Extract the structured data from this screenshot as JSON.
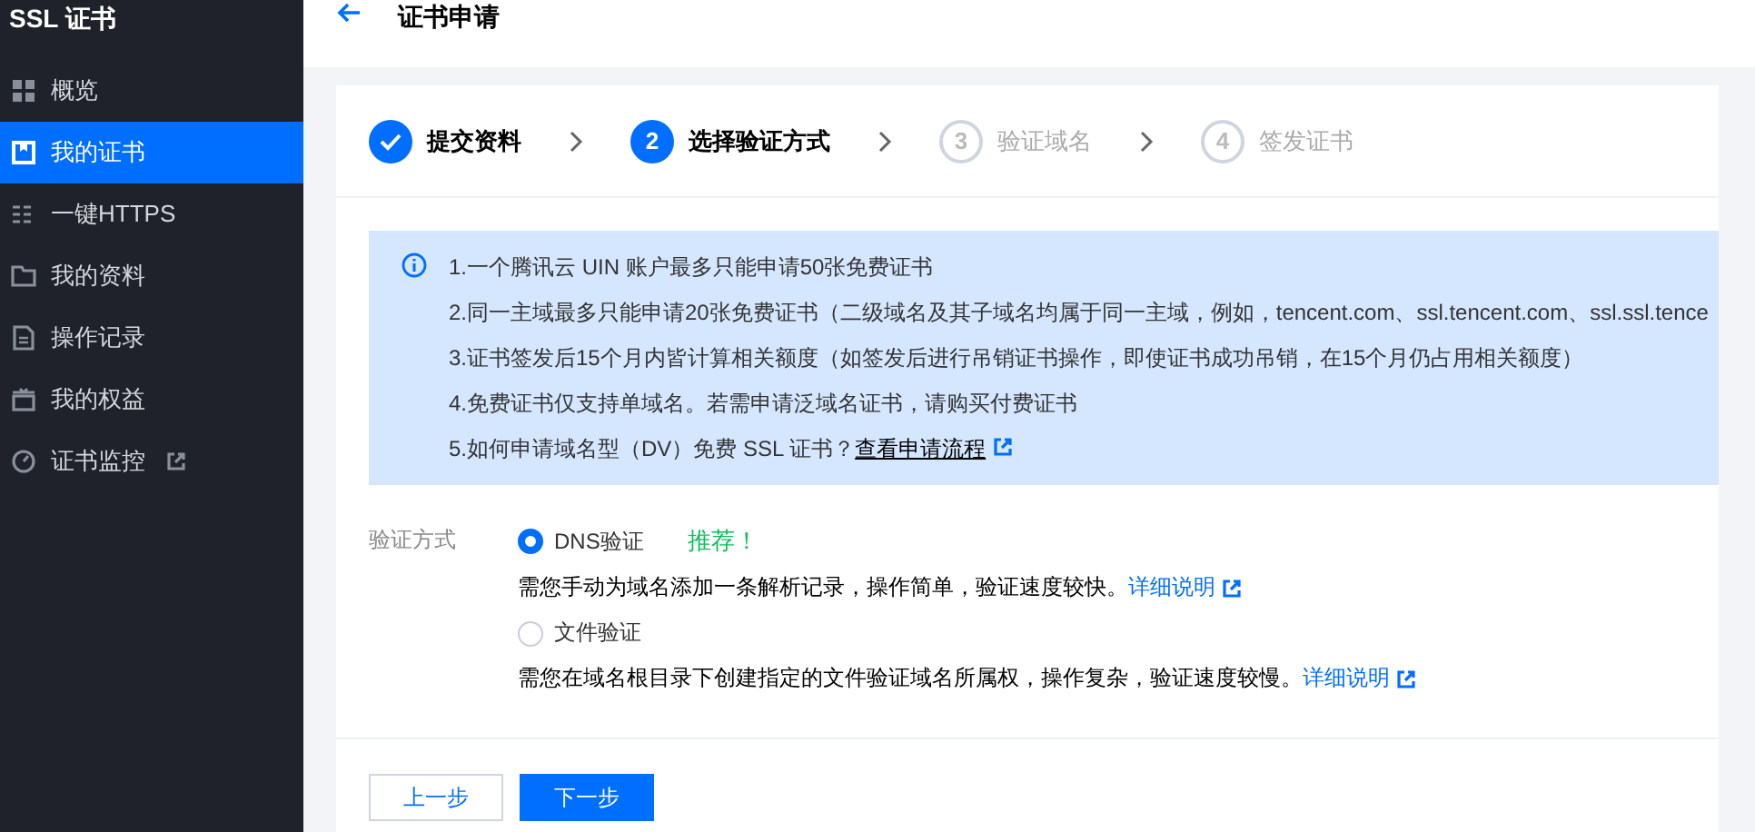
{
  "sidebar": {
    "title": "SSL 证书",
    "items": [
      {
        "label": "概览",
        "selected": false,
        "external": false
      },
      {
        "label": "我的证书",
        "selected": true,
        "external": false
      },
      {
        "label": "一键HTTPS",
        "selected": false,
        "external": false
      },
      {
        "label": "我的资料",
        "selected": false,
        "external": false
      },
      {
        "label": "操作记录",
        "selected": false,
        "external": false
      },
      {
        "label": "我的权益",
        "selected": false,
        "external": false
      },
      {
        "label": "证书监控",
        "selected": false,
        "external": true
      }
    ]
  },
  "header": {
    "title": "证书申请"
  },
  "steps": [
    {
      "label": "提交资料",
      "completed": true,
      "selected": false
    },
    {
      "number": "2",
      "label": "选择验证方式",
      "completed": false,
      "selected": true
    },
    {
      "number": "3",
      "label": "验证域名",
      "completed": false,
      "selected": false
    },
    {
      "number": "4",
      "label": "签发证书",
      "completed": false,
      "selected": false
    }
  ],
  "notice": {
    "lines": [
      {
        "text": "1.一个腾讯云 UIN 账户最多只能申请50张免费证书"
      },
      {
        "text": "2.同一主域最多只能申请20张免费证书（二级域名及其子域名均属于同一主域，例如，tencent.com、ssl.tencent.com、ssl.ssl.tence"
      },
      {
        "text": "3.证书签发后15个月内皆计算相关额度（如签发后进行吊销证书操作，即使证书成功吊销，在15个月仍占用相关额度）"
      },
      {
        "text": "4.免费证书仅支持单域名。若需申请泛域名证书，请购买付费证书"
      },
      {
        "text": "5.如何申请域名型（DV）免费 SSL 证书？",
        "link": "查看申请流程"
      }
    ]
  },
  "verification": {
    "label": "验证方式",
    "options": [
      {
        "label": "DNS验证",
        "badge": "推荐！",
        "selected": true,
        "description": "需您手动为域名添加一条解析记录，操作简单，验证速度较快。",
        "link": "详细说明"
      },
      {
        "label": "文件验证",
        "selected": false,
        "description": "需您在域名根目录下创建指定的文件验证域名所属权，操作复杂，验证速度较慢。",
        "link": "详细说明"
      }
    ]
  },
  "buttons": [
    {
      "label": "上一步",
      "kind": "secondary"
    },
    {
      "label": "下一步",
      "kind": "primary"
    }
  ]
}
